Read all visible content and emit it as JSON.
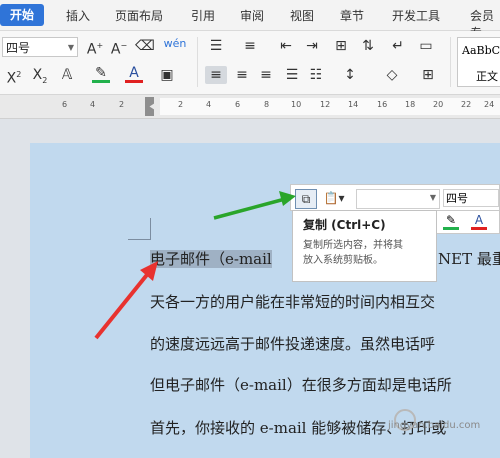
{
  "tabs": [
    "开始",
    "插入",
    "页面布局",
    "引用",
    "审阅",
    "视图",
    "章节",
    "开发工具",
    "会员专"
  ],
  "ribbon": {
    "font_size": "四号",
    "phonetic_label": "wén",
    "style_preview_1": "AaBbC",
    "style_preview_2": "正文"
  },
  "ruler": {
    "marks": [
      "6",
      "4",
      "2",
      "2",
      "4",
      "6",
      "8",
      "10",
      "12",
      "14",
      "16",
      "18",
      "20",
      "22",
      "24"
    ]
  },
  "mini_toolbar": {
    "font_size": "四号"
  },
  "tooltip": {
    "title": "复制 (Ctrl+C)",
    "line1": "复制所选内容，并将其",
    "line2": "放入系统剪贴板。"
  },
  "document": {
    "line1_selected": "电子邮件（e-mail",
    "line1_rest": "NET 最重",
    "line2": "天各一方的用户能在非常短的时间内相互交",
    "line3": "的速度远远高于邮件投递速度。虽然电话呼",
    "line4": "但电子邮件（e-mail）在很多方面却是电话所",
    "line5": "首先，你接收的 e-mail 能够被储存、打印或"
  },
  "watermark": "jingyan.baidu.com",
  "colors": {
    "accent": "#2f74d8",
    "highlight_green": "#22b14c",
    "font_red": "#e02020",
    "page_blue": "#c1d9ee",
    "arrow_green": "#2aa52a",
    "arrow_red": "#e8322f"
  }
}
